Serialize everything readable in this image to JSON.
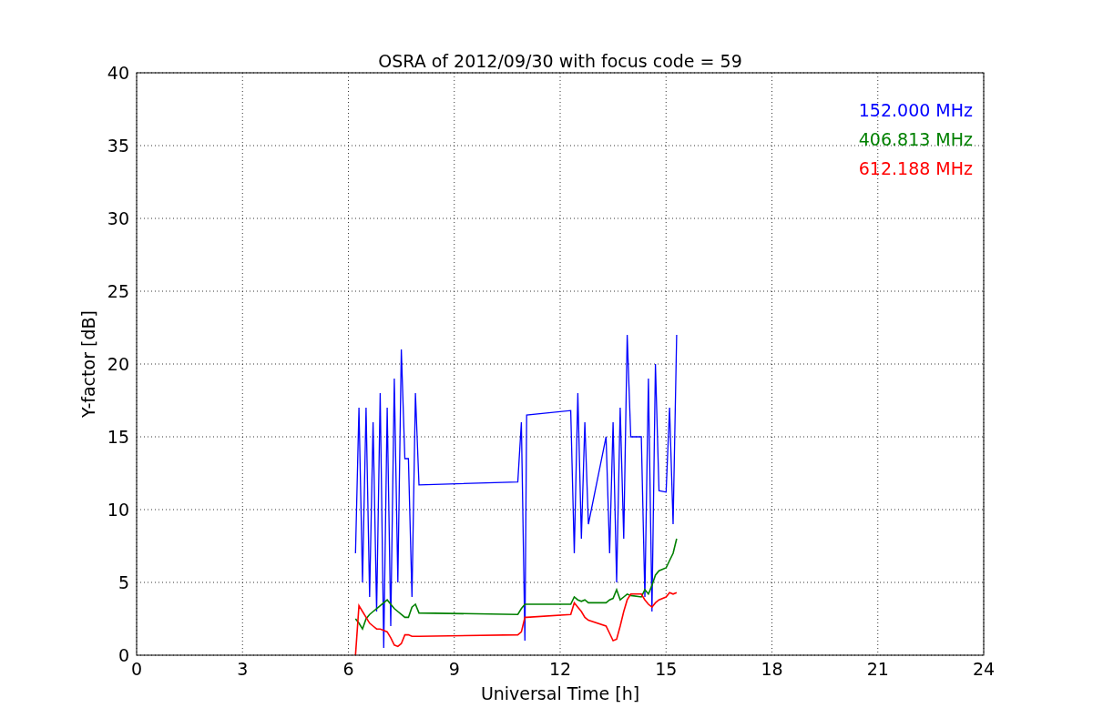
{
  "chart_data": {
    "type": "line",
    "grid": true,
    "title": "OSRA of 2012/09/30 with focus code = 59",
    "xlabel": "Universal Time [h]",
    "ylabel": "Y-factor [dB]",
    "x": [
      6.2,
      6.3,
      6.4,
      6.5,
      6.6,
      6.7,
      6.8,
      6.9,
      7.0,
      7.1,
      7.2,
      7.3,
      7.4,
      7.5,
      7.6,
      7.7,
      7.8,
      7.9,
      8.0,
      10.8,
      10.9,
      11.0,
      11.05,
      12.3,
      12.4,
      12.5,
      12.6,
      12.7,
      12.8,
      13.3,
      13.4,
      13.5,
      13.6,
      13.7,
      13.8,
      13.9,
      14.0,
      14.3,
      14.4,
      14.5,
      14.6,
      14.7,
      14.8,
      15.0,
      15.1,
      15.2,
      15.3
    ],
    "series": [
      {
        "name": "152.000 MHz",
        "color": "#0000ff",
        "values": [
          7,
          17,
          5,
          17,
          4,
          16,
          3,
          18,
          0.5,
          17,
          2,
          19,
          5,
          21,
          13.5,
          13.5,
          4,
          18,
          11.7,
          11.9,
          16,
          1,
          16.5,
          16.8,
          7,
          18,
          8,
          16,
          9,
          15,
          7,
          16,
          5,
          17,
          8,
          22,
          15,
          15,
          4,
          19,
          3,
          20,
          11.3,
          11.2,
          17,
          9,
          22
        ]
      },
      {
        "name": "406.813 MHz",
        "color": "#008000",
        "values": [
          2.5,
          2.2,
          1.8,
          2.5,
          2.8,
          3.0,
          3.2,
          3.4,
          3.6,
          3.8,
          3.5,
          3.2,
          3.0,
          2.8,
          2.6,
          2.6,
          3.3,
          3.5,
          2.9,
          2.8,
          3.2,
          3.5,
          3.5,
          3.5,
          4.0,
          3.8,
          3.7,
          3.8,
          3.6,
          3.6,
          3.8,
          3.9,
          4.5,
          3.8,
          4.0,
          4.2,
          4.1,
          4.0,
          4.5,
          4.2,
          4.8,
          5.5,
          5.8,
          6.0,
          6.5,
          7.0,
          8.0
        ]
      },
      {
        "name": "612.188 MHz",
        "color": "#ff0000",
        "values": [
          0,
          3.4,
          3.0,
          2.6,
          2.2,
          2.0,
          1.8,
          1.8,
          1.7,
          1.6,
          1.2,
          0.7,
          0.6,
          0.8,
          1.4,
          1.4,
          1.3,
          1.3,
          1.3,
          1.4,
          1.6,
          2.6,
          2.6,
          2.8,
          3.6,
          3.3,
          3.0,
          2.6,
          2.4,
          2.0,
          1.5,
          1.0,
          1.1,
          2.0,
          3.0,
          3.8,
          4.2,
          4.2,
          3.8,
          3.5,
          3.3,
          3.6,
          3.8,
          4.0,
          4.3,
          4.2,
          4.3
        ]
      }
    ],
    "xlim": [
      0,
      24
    ],
    "ylim": [
      0,
      40
    ],
    "xticks": [
      0,
      3,
      6,
      9,
      12,
      15,
      18,
      21,
      24
    ],
    "yticks": [
      0,
      5,
      10,
      15,
      20,
      25,
      30,
      35,
      40
    ]
  }
}
